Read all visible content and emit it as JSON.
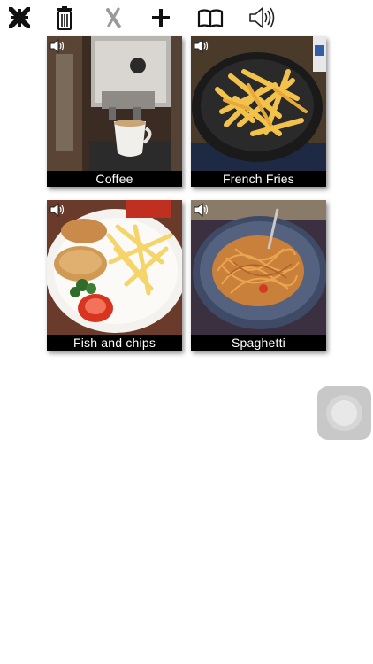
{
  "toolbar": {
    "buttons": [
      {
        "icon": "collapse-arrows-icon"
      },
      {
        "icon": "trash-icon"
      },
      {
        "icon": "cross-icon"
      },
      {
        "icon": "plus-icon"
      },
      {
        "icon": "book-icon"
      },
      {
        "icon": "speaker-icon"
      }
    ]
  },
  "tiles": [
    {
      "label": "Coffee",
      "icon": "speaker-icon"
    },
    {
      "label": "French Fries",
      "icon": "speaker-icon"
    },
    {
      "label": "Fish and chips",
      "icon": "speaker-icon"
    },
    {
      "label": "Spaghetti",
      "icon": "speaker-icon"
    }
  ],
  "colors": {
    "caption_bg": "#000000",
    "caption_text": "#ffffff",
    "assistive_touch": "#c8c8c8"
  }
}
